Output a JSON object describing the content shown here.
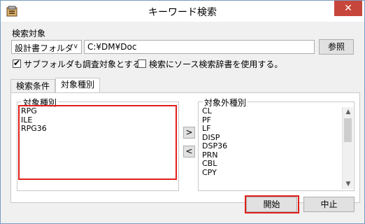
{
  "window": {
    "title": "キーワード検索",
    "close_glyph": "✕"
  },
  "search_target": {
    "group_label": "検索対象",
    "folder_type": "設計書フォルダ",
    "path": "C:¥DM¥Doc",
    "browse_label": "参照"
  },
  "options": {
    "include_subfolders_label": "サブフォルダも調査対象とする。",
    "include_subfolders_checked": true,
    "use_source_dictionary_label": "検索にソース検索辞書を使用する。",
    "use_source_dictionary_checked": false,
    "checkmark": "✔"
  },
  "tabs": [
    {
      "label": "検索条件",
      "active": false
    },
    {
      "label": "対象種別",
      "active": true
    }
  ],
  "target_types": {
    "label": "対象種別",
    "items": [
      "RPG",
      "ILE",
      "RPG36"
    ]
  },
  "excluded_types": {
    "label": "対象外種別",
    "items": [
      "CL",
      "PF",
      "LF",
      "DISP",
      "DSP36",
      "PRN",
      "CBL",
      "CPY"
    ]
  },
  "move_buttons": {
    "to_right": ">",
    "to_left": "<"
  },
  "scroll": {
    "up_glyph": "▲",
    "down_glyph": "▼"
  },
  "actions": {
    "start_label": "開始",
    "cancel_label": "中止"
  },
  "highlight_color": "#e0201b"
}
